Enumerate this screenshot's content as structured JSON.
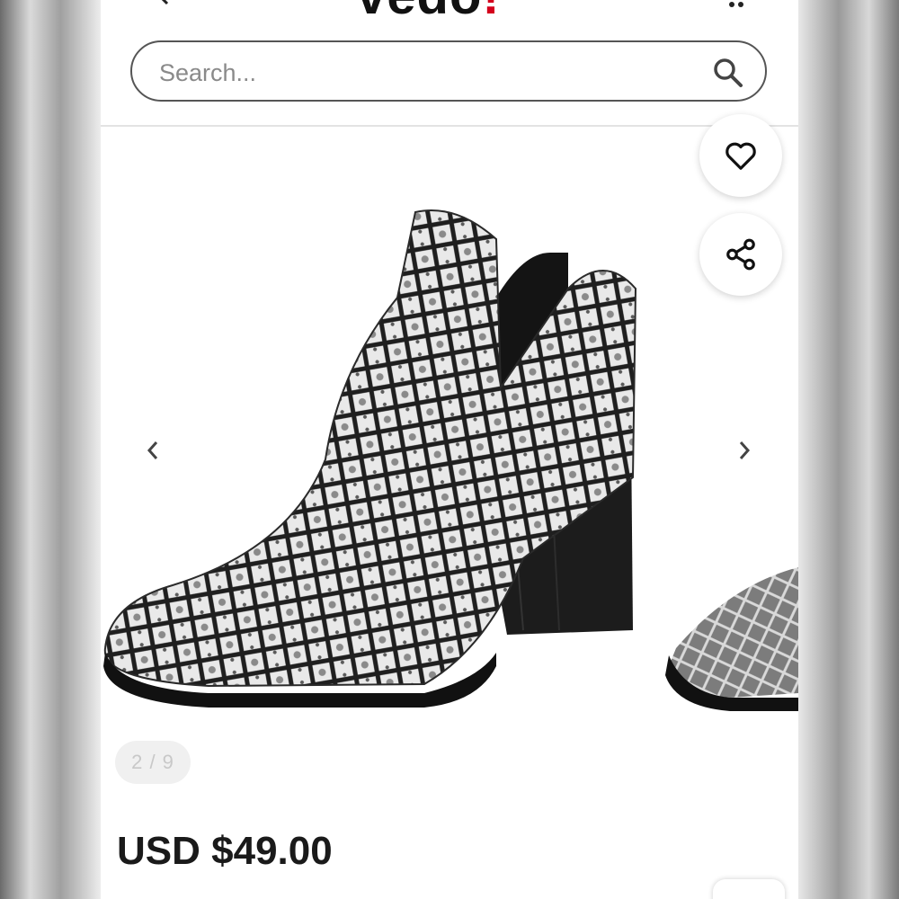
{
  "header": {
    "logo_text": "vedo",
    "logo_dot": "!",
    "back_icon": "chevron-left-icon",
    "more_icon": "more-dots-icon"
  },
  "search": {
    "placeholder": "Search...",
    "value": "",
    "icon": "search-icon"
  },
  "gallery": {
    "favorite_icon": "heart-icon",
    "share_icon": "share-icon",
    "prev_icon": "chevron-left-icon",
    "next_icon": "chevron-right-icon",
    "counter": "2 / 9",
    "current_index": 2,
    "total": 9
  },
  "product": {
    "price": "USD $49.00"
  },
  "colors": {
    "brand_accent": "#d4001c",
    "text": "#1a1a1a"
  }
}
